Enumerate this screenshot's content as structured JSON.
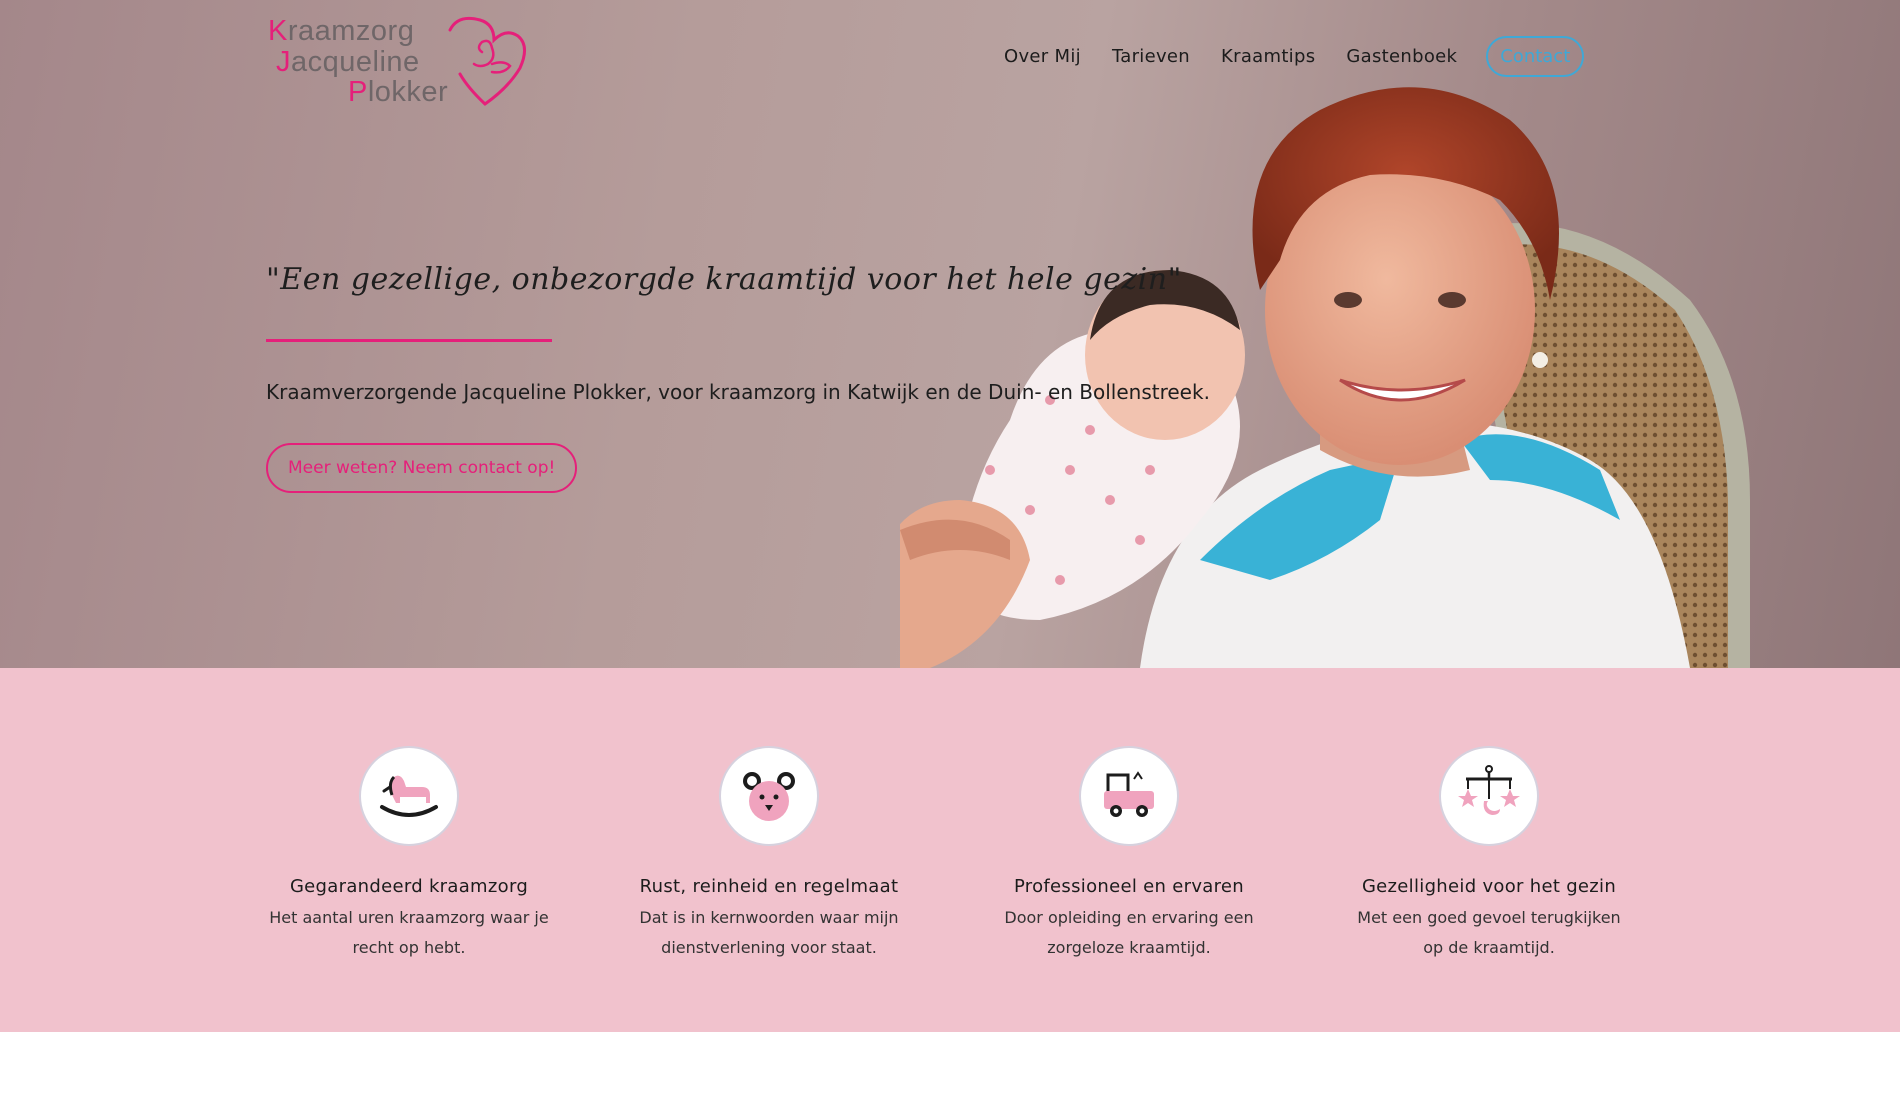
{
  "brand": {
    "logo_line1_first": "K",
    "logo_line1_rest": "raamzorg",
    "logo_line2_first": "J",
    "logo_line2_rest": "acqueline",
    "logo_line3_first": "P",
    "logo_line3_rest": "lokker",
    "logo_icon": "heart-mother-baby-icon"
  },
  "nav": {
    "items": [
      "Over Mij",
      "Tarieven",
      "Kraamtips",
      "Gastenboek"
    ],
    "contact_label": "Contact"
  },
  "hero": {
    "tagline": "\"Een gezellige, onbezorgde kraamtijd voor het hele gezin\"",
    "subtitle": "Kraamverzorgende Jacqueline Plokker, voor kraamzorg in Katwijk en de Duin- en Bollenstreek.",
    "cta_label": "Meer weten? Neem contact op!"
  },
  "features": [
    {
      "icon": "rocking-horse-icon",
      "title": "Gegarandeerd kraamzorg",
      "desc": "Het aantal uren kraamzorg waar je recht op hebt."
    },
    {
      "icon": "teddy-bear-icon",
      "title": "Rust, reinheid en regelmaat",
      "desc": "Dat is in kernwoorden waar mijn dienstverlening voor staat."
    },
    {
      "icon": "toy-car-icon",
      "title": "Professioneel en ervaren",
      "desc": "Door opleiding en ervaring een zorgeloze kraamtijd."
    },
    {
      "icon": "baby-mobile-icon",
      "title": "Gezelligheid voor het gezin",
      "desc": "Met een goed gevoel terugkijken op de kraamtijd."
    }
  ],
  "colors": {
    "accent_pink": "#e5207a",
    "contact_blue": "#3fa8d6",
    "features_bg": "#f1c2cd",
    "icon_pink": "#f0a3be"
  }
}
